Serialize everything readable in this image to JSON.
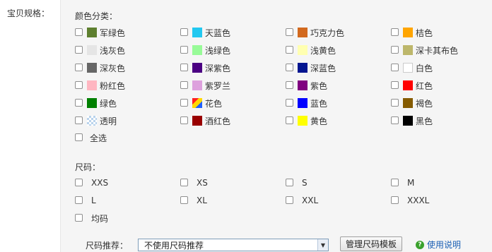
{
  "field_label": "宝贝规格：",
  "colors_heading": "颜色分类：",
  "colors": [
    {
      "label": "军绿色",
      "swatch": "#5e7f2f"
    },
    {
      "label": "天蓝色",
      "swatch": "#22c8f0"
    },
    {
      "label": "巧克力色",
      "swatch": "#d2691e"
    },
    {
      "label": "桔色",
      "swatch": "#ffa500"
    },
    {
      "label": "浅灰色",
      "swatch": "#e5e5e5"
    },
    {
      "label": "浅绿色",
      "swatch": "#98fb98"
    },
    {
      "label": "浅黄色",
      "swatch": "#ffffb0"
    },
    {
      "label": "深卡其布色",
      "swatch": "#bdb76b"
    },
    {
      "label": "深灰色",
      "swatch": "#666666"
    },
    {
      "label": "深紫色",
      "swatch": "#4b0082"
    },
    {
      "label": "深蓝色",
      "swatch": "#041690"
    },
    {
      "label": "白色",
      "swatch": "#ffffff"
    },
    {
      "label": "粉红色",
      "swatch": "#ffb6c1"
    },
    {
      "label": "紫罗兰",
      "swatch": "#dda0dd"
    },
    {
      "label": "紫色",
      "swatch": "#800080"
    },
    {
      "label": "红色",
      "swatch": "#ff0000"
    },
    {
      "label": "绿色",
      "swatch": "#008000"
    },
    {
      "label": "花色",
      "swatch": "pattern"
    },
    {
      "label": "蓝色",
      "swatch": "#0000ff"
    },
    {
      "label": "褐色",
      "swatch": "#855b00"
    },
    {
      "label": "透明",
      "swatch": "transparent"
    },
    {
      "label": "酒红色",
      "swatch": "#990000"
    },
    {
      "label": "黄色",
      "swatch": "#ffff00"
    },
    {
      "label": "黑色",
      "swatch": "#000000"
    }
  ],
  "select_all_label": "全选",
  "sizes_heading": "尺码：",
  "sizes": [
    "XXS",
    "XS",
    "S",
    "M",
    "L",
    "XL",
    "XXL",
    "XXXL",
    "均码"
  ],
  "size_recommend_label": "尺码推荐：",
  "size_recommend_value": "不使用尺码推荐",
  "manage_button_label": "管理尺码模板",
  "help_label": "使用说明"
}
